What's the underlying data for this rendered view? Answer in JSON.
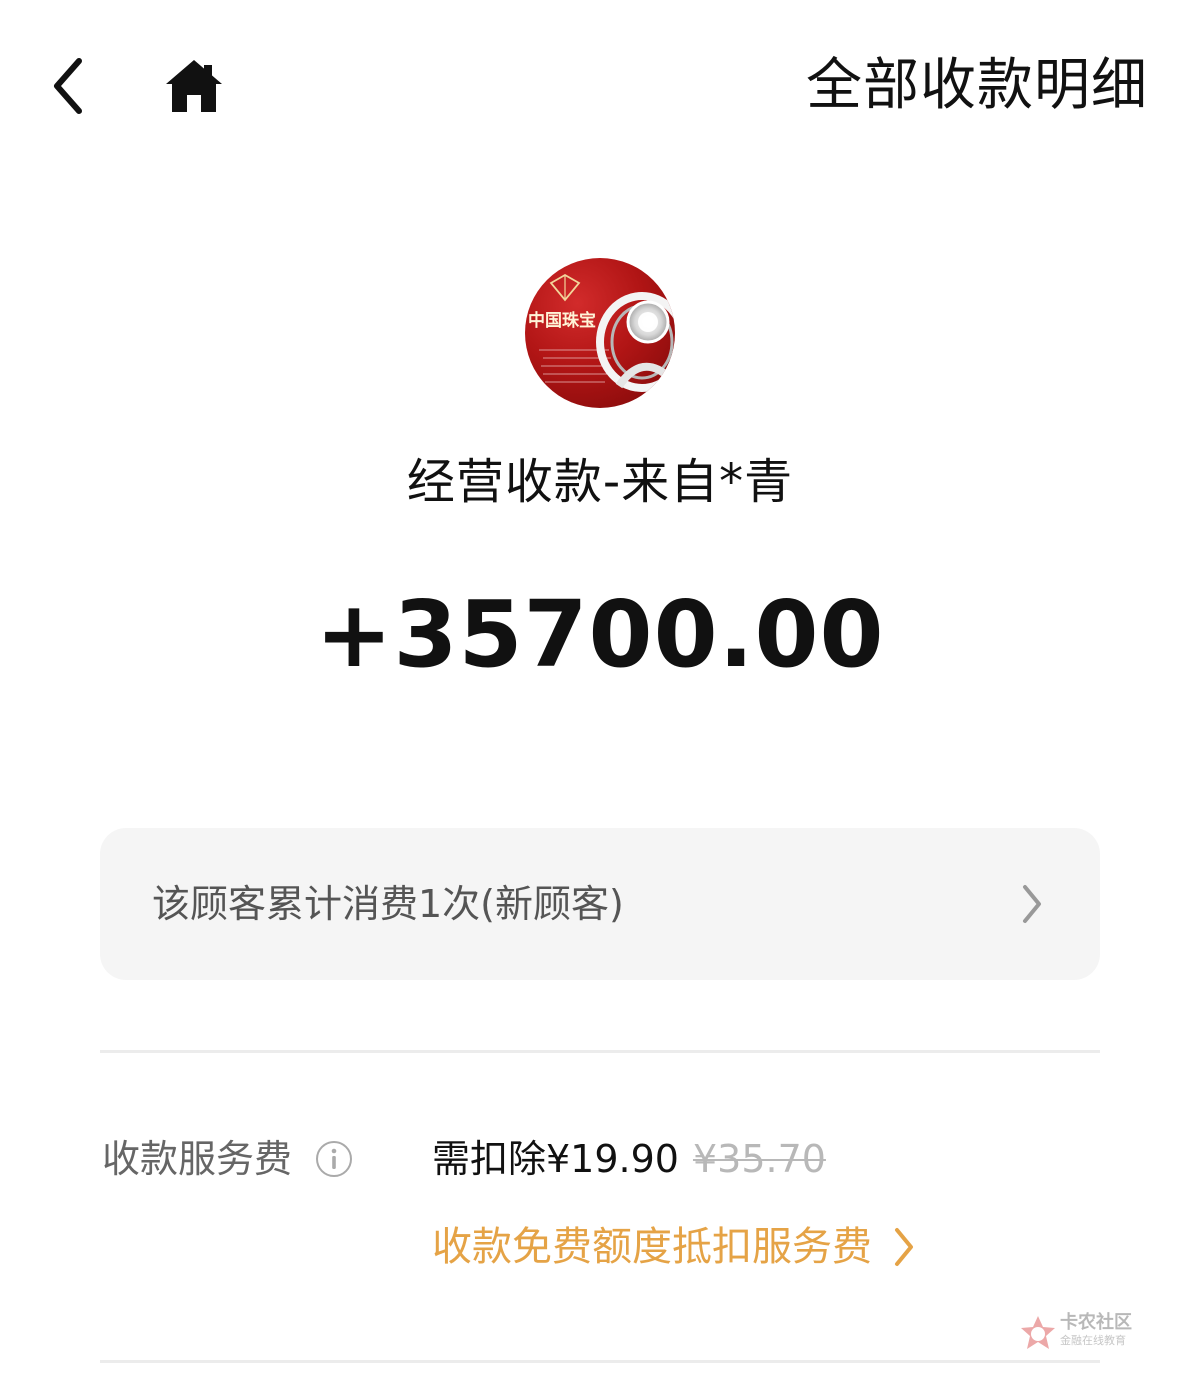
{
  "header": {
    "title": "全部收款明细",
    "back_icon": "chevron-left-icon",
    "home_icon": "home-icon"
  },
  "avatar": {
    "logo_text": "中国珠宝",
    "brand_color": "#b11515"
  },
  "payment": {
    "title": "经营收款-来自*青",
    "amount": "+35700.00"
  },
  "customer_summary": {
    "text": "该顾客累计消费1次(新顾客)",
    "chevron_icon": "chevron-right-icon"
  },
  "fee": {
    "label": "收款服务费",
    "info_icon": "info-icon",
    "value": "需扣除¥19.90",
    "original_value": "¥35.70",
    "link_text": "收款免费额度抵扣服务费",
    "link_color": "#e5a346",
    "link_chevron_icon": "chevron-right-icon"
  },
  "watermark": {
    "title": "卡农社区",
    "subtitle": "金融在线教育"
  },
  "colors": {
    "text_primary": "#111111",
    "text_secondary": "#666666",
    "card_background": "#f5f5f5",
    "divider": "#ececec",
    "muted": "#b8b8b8"
  }
}
